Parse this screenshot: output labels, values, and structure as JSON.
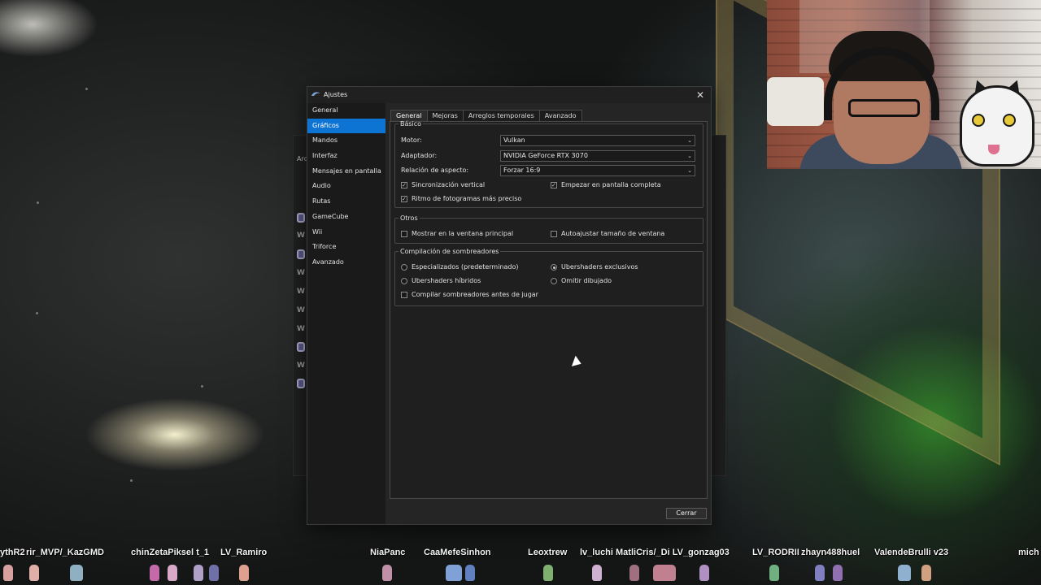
{
  "background_window": {
    "title_fragment": "Arc",
    "rows": [
      "W",
      "W",
      "W",
      "W",
      "W",
      "W"
    ]
  },
  "dialog": {
    "title": "Ajustes",
    "sidebar": [
      {
        "label": "General",
        "active": false
      },
      {
        "label": "Gráficos",
        "active": true
      },
      {
        "label": "Mandos",
        "active": false
      },
      {
        "label": "Interfaz",
        "active": false
      },
      {
        "label": "Mensajes en pantalla",
        "active": false
      },
      {
        "label": "Audio",
        "active": false
      },
      {
        "label": "Rutas",
        "active": false
      },
      {
        "label": "GameCube",
        "active": false
      },
      {
        "label": "Wii",
        "active": false
      },
      {
        "label": "Triforce",
        "active": false
      },
      {
        "label": "Avanzado",
        "active": false
      }
    ],
    "tabs": [
      {
        "label": "General",
        "active": true
      },
      {
        "label": "Mejoras",
        "active": false
      },
      {
        "label": "Arreglos temporales",
        "active": false
      },
      {
        "label": "Avanzado",
        "active": false
      }
    ],
    "basico": {
      "legend": "Básico",
      "motor_label": "Motor:",
      "motor_value": "Vulkan",
      "adaptador_label": "Adaptador:",
      "adaptador_value": "NVIDIA GeForce RTX 3070",
      "aspecto_label": "Relación de aspecto:",
      "aspecto_value": "Forzar 16:9",
      "vsync_label": "Sincronización vertical",
      "vsync_checked": true,
      "fullscreen_label": "Empezar en pantalla completa",
      "fullscreen_checked": true,
      "framepacing_label": "Ritmo de fotogramas más preciso",
      "framepacing_checked": true
    },
    "otros": {
      "legend": "Otros",
      "render_main_label": "Mostrar en la ventana principal",
      "render_main_checked": false,
      "autoresize_label": "Autoajustar tamaño de ventana",
      "autoresize_checked": false
    },
    "shaders": {
      "legend": "Compilación de sombreadores",
      "specialized_label": "Especializados (predeterminado)",
      "exclusive_label": "Ubershaders exclusivos",
      "hybrid_label": "Ubershaders híbridos",
      "skip_label": "Omitir dibujado",
      "selected": "exclusive",
      "precompile_label": "Compilar sombreadores antes de jugar",
      "precompile_checked": false
    },
    "close_button": "Cerrar"
  },
  "chat_names": [
    "ythR2",
    "rir_MVP/_KazGMD",
    "chinZetaPiksel t_1",
    "LV_Ramiro",
    "NiaPanc",
    "CaaMefeSinhon",
    "Leoxtrew",
    "lv_luchi MatliCris/_Di LV_gonzag03",
    "LV_RODRII",
    "zhayn488huel",
    "ValendeBrulli v23",
    "mich"
  ],
  "colors": {
    "accent": "#0e74d4",
    "dialog_bg": "#1e1e1e",
    "pane_bg": "#1f1f1f"
  },
  "icons": [
    "dolphin-app-icon",
    "close-icon",
    "chevron-down-icon",
    "mouse-cursor-icon"
  ]
}
